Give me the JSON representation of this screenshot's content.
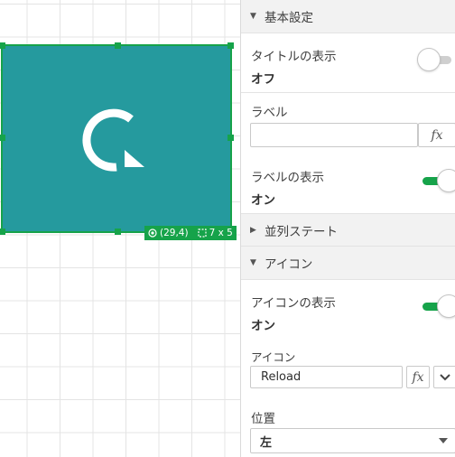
{
  "canvas": {
    "widget_color": "#259a9e",
    "selection_color": "#16a34a",
    "icon": "reload-icon",
    "badge": {
      "position": "(29,4)",
      "size": "7 x 5"
    }
  },
  "panel": {
    "basic_settings": {
      "header": "基本設定",
      "expanded": true,
      "show_title": {
        "label": "タイトルの表示",
        "value": "オフ",
        "on": false
      },
      "label_field": {
        "label": "ラベル",
        "value": "",
        "fx": "fx"
      },
      "show_label": {
        "label": "ラベルの表示",
        "value": "オン",
        "on": true
      }
    },
    "parallel_state": {
      "header": "並列ステート",
      "expanded": false
    },
    "icon_section": {
      "header": "アイコン",
      "expanded": true,
      "show_icon": {
        "label": "アイコンの表示",
        "value": "オン",
        "on": true
      },
      "icon_field": {
        "label": "アイコン",
        "value": "Reload",
        "fx": "fx"
      },
      "position": {
        "label": "位置",
        "value": "左"
      }
    }
  }
}
